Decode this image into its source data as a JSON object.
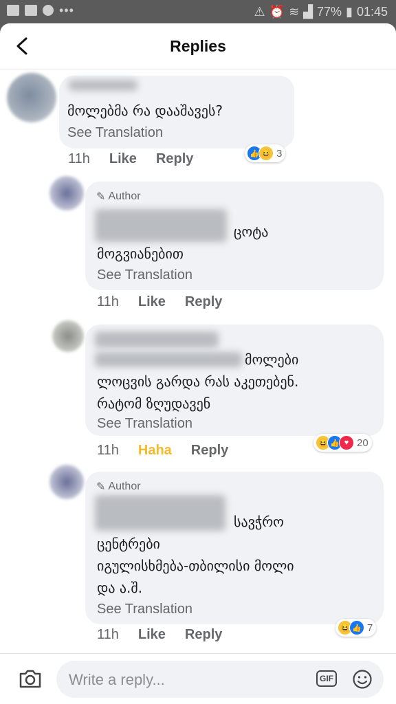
{
  "status_bar": {
    "battery": "77%",
    "time": "01:45"
  },
  "header": {
    "title": "Replies"
  },
  "comments": [
    {
      "text_lines": [
        "მოლებმა რა დააშავეს?"
      ],
      "see_translation": "See Translation",
      "time": "11h",
      "like": "Like",
      "reply": "Reply",
      "reactions": {
        "icons": [
          "like-icon",
          "haha-icon"
        ],
        "count": "3"
      }
    },
    {
      "author_badge": "Author",
      "text_lines": [
        "ცოტა",
        "მოგვიანებით"
      ],
      "see_translation": "See Translation",
      "time": "11h",
      "like": "Like",
      "reply": "Reply"
    },
    {
      "text_lines": [
        "მოლები",
        "ლოცვის გარდა რას აკეთებენ.",
        "რატომ ზღუდავენ"
      ],
      "see_translation": "See Translation",
      "time": "11h",
      "like": "Haha",
      "reply": "Reply",
      "like_color": "#f7b928",
      "reactions": {
        "icons": [
          "haha-icon",
          "like-icon",
          "love-icon"
        ],
        "count": "20"
      }
    },
    {
      "author_badge": "Author",
      "text_lines": [
        "სავჭრო",
        "ცენტრები",
        "იგულისხმება-თბილისი მოლი",
        "და ა.შ."
      ],
      "see_translation": "See Translation",
      "time": "11h",
      "like": "Like",
      "reply": "Reply",
      "reactions": {
        "icons": [
          "haha-icon",
          "like-icon"
        ],
        "count": "7"
      }
    }
  ],
  "composer": {
    "placeholder": "Write a reply...",
    "gif_label": "GIF"
  },
  "colors": {
    "like": "#1877f2",
    "haha": "#f7b928",
    "love": "#f02849",
    "bubble": "#f0f2f5",
    "meta_text": "#65676b"
  }
}
